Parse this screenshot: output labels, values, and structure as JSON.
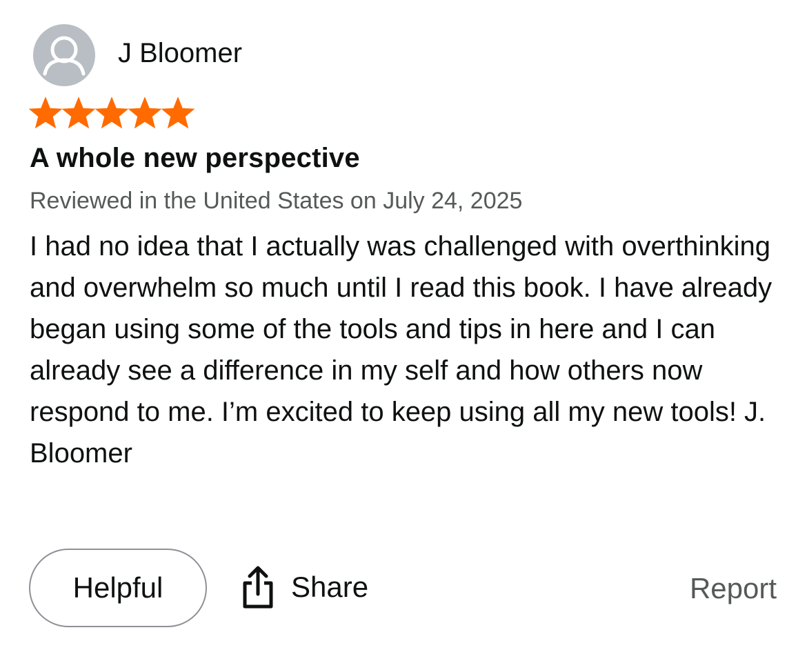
{
  "reviewer": {
    "name": "J Bloomer",
    "avatar_icon": "default-user-avatar-icon"
  },
  "rating": {
    "stars": 5,
    "max": 5,
    "color": "#ff6b00"
  },
  "review": {
    "title": "A whole new perspective",
    "meta": "Reviewed in the United States on July 24, 2025",
    "body": "I had no idea that I actually was challenged with overthinking and overwhelm so much until I read this book. I have already began using some of the tools and tips in here and I can already see a difference in my self and how others now respond to me. I’m excited to keep using all my new tools! J. Bloomer"
  },
  "actions": {
    "helpful_label": "Helpful",
    "share_label": "Share",
    "share_icon": "share-icon",
    "report_label": "Report"
  }
}
